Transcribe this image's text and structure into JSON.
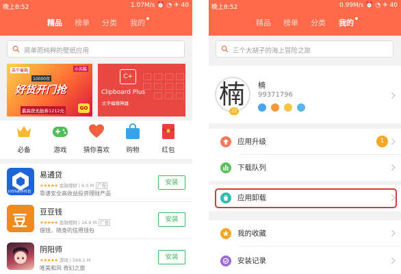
{
  "left": {
    "status": {
      "time": "晚上8:52",
      "speed": "1.07M/s",
      "battery": "40"
    },
    "tabs": [
      "精品",
      "榜单",
      "分类",
      "我的"
    ],
    "active_tab": "精品",
    "search_placeholder": "简单而纯粹的壁纸应用",
    "banner1": {
      "brand": "苏宁易购",
      "tag": "小苏酷",
      "top": "10000台",
      "title": "好货开门抢",
      "price": "最高获无敌券1212元",
      "go": "GO"
    },
    "banner2": {
      "logo": "C+",
      "title": "Clipboard Plus",
      "subtitle": "文字编辑神器"
    },
    "categories": [
      "必备",
      "游戏",
      "猜你喜欢",
      "购物",
      "红包"
    ],
    "apps": [
      {
        "name": "易通贷",
        "stars": "★★★★★",
        "category": "金融理财",
        "size": "9.0 M",
        "ad": "广告",
        "desc": "靠谱安全高收益投资理财产品",
        "button": "安装",
        "icon_text": "100%新手红包"
      },
      {
        "name": "豆豆钱",
        "stars": "★★★★★",
        "category": "金融理财",
        "size": "16.9 M",
        "ad": "广告",
        "desc": "借钱，随身的信用钱包",
        "button": "安装",
        "icon_text": "豆"
      },
      {
        "name": "阴阳师",
        "stars": "★★★★★",
        "category": "游戏",
        "size": "566.1 M",
        "ad": "",
        "desc": "唯美和风 奇幻之旅",
        "button": "安装",
        "icon_text": ""
      }
    ]
  },
  "right": {
    "status": {
      "time": "晚上8:52",
      "speed": "0.99M/s",
      "battery": "40"
    },
    "tabs": [
      "精品",
      "榜单",
      "分类",
      "我的"
    ],
    "active_tab": "我的",
    "search_placeholder": "三个大胡子的海上冒险之旅",
    "profile": {
      "avatar_glyph": "楠",
      "level": "22",
      "name": "楠",
      "id": "99371796"
    },
    "menu": [
      {
        "label": "应用升级",
        "count": "1",
        "color": "#f07a5a"
      },
      {
        "label": "下载队列",
        "count": "",
        "color": "#5cc05f"
      },
      {
        "label": "应用卸载",
        "count": "",
        "color": "#36b9b2"
      },
      {
        "label": "我的收藏",
        "count": "",
        "color": "#f5a623"
      },
      {
        "label": "安装记录",
        "count": "",
        "color": "#9b6bd8"
      }
    ]
  },
  "colors": {
    "accent": "#ff6b4a",
    "install": "#3dba5e",
    "highlight": "#d13b3b"
  }
}
